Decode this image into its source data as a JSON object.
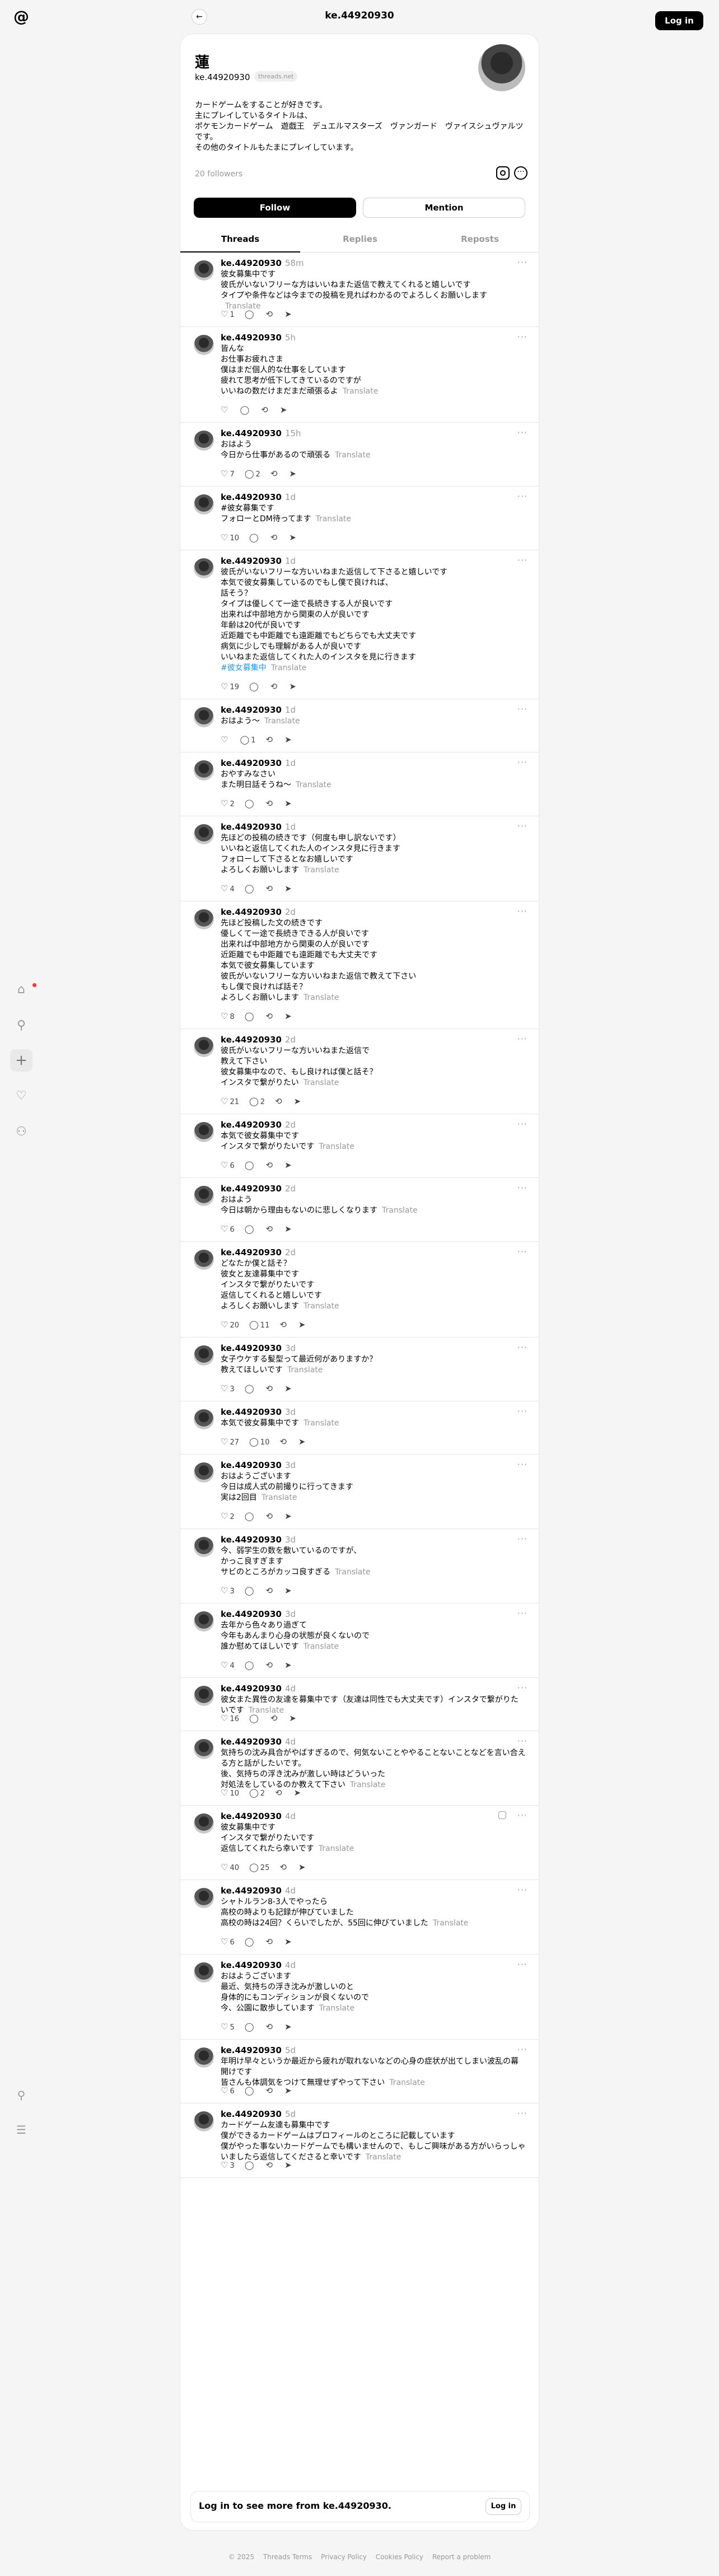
{
  "header": {
    "title": "ke.44920930",
    "login_label": "Log in",
    "back_icon": "arrow-left-icon"
  },
  "profile": {
    "name": "蓮",
    "handle": "ke.44920930",
    "chip": "threads.net",
    "bio": "カードゲームをすることが好きです。\n主にプレイしているタイトルは、\nポケモンカードゲーム　遊戯王　デュエルマスターズ　ヴァンガード　ヴァイスシュヴァルツです。\nその他のタイトルもたまにプレイしています。",
    "followers": "20 followers",
    "follow_label": "Follow",
    "mention_label": "Mention"
  },
  "tabs": [
    "Threads",
    "Replies",
    "Reposts"
  ],
  "translate_label": "Translate",
  "posts": [
    {
      "time": "58m",
      "lines": [
        "彼女募集中です",
        "彼氏がいないフリーな方はいいねまた返信で教えてくれると嬉しいです",
        "タイプや条件などは今までの投稿を見ればわかるのでよろしくお願いします"
      ],
      "likes": "1",
      "replies": "",
      "reposts": ""
    },
    {
      "time": "5h",
      "lines": [
        "皆んな",
        "お仕事お疲れさま",
        "僕はまだ個人的な仕事をしています",
        "疲れて思考が低下してきているのですが",
        "いいねの数だけまだまだ頑張るよ"
      ],
      "likes": "",
      "replies": "",
      "reposts": ""
    },
    {
      "time": "15h",
      "lines": [
        "おはよう",
        "今日から仕事があるので頑張る"
      ],
      "likes": "7",
      "replies": "2",
      "reposts": ""
    },
    {
      "time": "1d",
      "lines": [
        "#彼女募集です",
        "フォローとDM待ってます"
      ],
      "likes": "10",
      "replies": "",
      "reposts": ""
    },
    {
      "time": "1d",
      "lines": [
        "彼氏がいないフリーな方いいねまた返信して下さると嬉しいです",
        "本気で彼女募集しているのでもし僕で良ければ、",
        "話そう？",
        "タイプは優しくて一途で長続きする人が良いです",
        "出来れば中部地方から関東の人が良いです",
        "年齢は20代が良いです",
        "近距離でも中距離でも遠距離でもどちらでも大丈夫です",
        "病気に少しでも理解がある人が良いです",
        "いいねまた返信してくれた人のインスタを見に行きます",
        "#彼女募集中"
      ],
      "likes": "19",
      "replies": "",
      "reposts": ""
    },
    {
      "time": "1d",
      "lines": [
        "おはよう〜"
      ],
      "likes": "",
      "replies": "1",
      "reposts": ""
    },
    {
      "time": "1d",
      "lines": [
        "おやすみなさい",
        "また明日話そうね〜"
      ],
      "likes": "2",
      "replies": "",
      "reposts": ""
    },
    {
      "time": "1d",
      "lines": [
        "先ほどの投稿の続きです（何度も申し訳ないです）",
        "いいねと返信してくれた人のインスタ見に行きます",
        "フォローして下さるとなお嬉しいです",
        "よろしくお願いします"
      ],
      "likes": "4",
      "replies": "",
      "reposts": ""
    },
    {
      "time": "2d",
      "lines": [
        "先ほど投稿した文の続きです",
        "優しくて一途で長続きできる人が良いです",
        "出来れば中部地方から関東の人が良いです",
        "近距離でも中距離でも遠距離でも大丈夫です",
        "本気で彼女募集しています",
        "彼氏がいないフリーな方いいねまた返信で教えて下さい",
        "もし僕で良ければ話そ？",
        "よろしくお願いします"
      ],
      "likes": "8",
      "replies": "",
      "reposts": ""
    },
    {
      "time": "2d",
      "lines": [
        "彼氏がいないフリーな方いいねまた返信で",
        "教えて下さい",
        "彼女募集中なので、もし良ければ僕と話そ？",
        "インスタで繋がりたい"
      ],
      "likes": "21",
      "replies": "2",
      "reposts": ""
    },
    {
      "time": "2d",
      "lines": [
        "本気で彼女募集中です",
        "インスタで繋がりたいです"
      ],
      "likes": "6",
      "replies": "",
      "reposts": ""
    },
    {
      "time": "2d",
      "lines": [
        "おはよう",
        "今日は朝から理由もないのに悲しくなります"
      ],
      "likes": "6",
      "replies": "",
      "reposts": ""
    },
    {
      "time": "2d",
      "lines": [
        "どなたか僕と話そ？",
        "彼女と友達募集中です",
        "インスタで繋がりたいです",
        "返信してくれると嬉しいです",
        "よろしくお願いします"
      ],
      "likes": "20",
      "replies": "11",
      "reposts": ""
    },
    {
      "time": "3d",
      "lines": [
        "女子ウケする髪型って最近何がありますか？",
        "教えてほしいです"
      ],
      "likes": "3",
      "replies": "",
      "reposts": ""
    },
    {
      "time": "3d",
      "lines": [
        "本気で彼女募集中です"
      ],
      "likes": "27",
      "replies": "10",
      "reposts": ""
    },
    {
      "time": "3d",
      "lines": [
        "おはようございます",
        "今日は成人式の前撮りに行ってきます",
        "実は2回目"
      ],
      "likes": "2",
      "replies": "",
      "reposts": ""
    },
    {
      "time": "3d",
      "lines": [
        "今、弱学生の数を敷いているのですが、",
        "かっこ良すぎます",
        "サビのところがカッコ良すぎる"
      ],
      "likes": "3",
      "replies": "",
      "reposts": ""
    },
    {
      "time": "3d",
      "lines": [
        "去年から色々あり過ぎて",
        "今年もあんまり心身の状態が良くないので",
        "誰か慰めてほしいです"
      ],
      "likes": "4",
      "replies": "",
      "reposts": ""
    },
    {
      "time": "4d",
      "lines": [
        "彼女また異性の友達を募集中です（友達は同性でも大丈夫です）インスタで繋がりたいです"
      ],
      "likes": "16",
      "replies": "",
      "reposts": ""
    },
    {
      "time": "4d",
      "lines": [
        "気持ちの沈み具合がやばすぎるので、何気ないことややることないことなどを言い合える方と話がしたいです。",
        "後、気持ちの浮き沈みが激しい時はどういった",
        "対処法をしているのか教えて下さい"
      ],
      "likes": "10",
      "replies": "2",
      "reposts": ""
    },
    {
      "time": "4d",
      "lines": [
        "彼女募集中です",
        "インスタで繋がりたいです",
        "返信してくれたら幸いです"
      ],
      "likes": "40",
      "replies": "25",
      "reposts": ""
    },
    {
      "time": "4d",
      "lines": [
        "シャトルラン8-3人でやったら",
        "高校の時よりも記録が伸びていました",
        "高校の時は24回？くらいでしたが、55回に伸びていました"
      ],
      "likes": "6",
      "replies": "",
      "reposts": ""
    },
    {
      "time": "4d",
      "lines": [
        "おはようございます",
        "最近、気持ちの浮き沈みが激しいのと",
        "身体的にもコンディションが良くないので",
        "今、公園に散歩しています"
      ],
      "likes": "5",
      "replies": "",
      "reposts": ""
    },
    {
      "time": "5d",
      "lines": [
        "年明け早々というか最近から疲れが取れないなどの心身の症状が出てしまい波乱の幕開けです",
        "皆さんも体調気をつけて無理せずやって下さい"
      ],
      "likes": "6",
      "replies": "",
      "reposts": ""
    },
    {
      "time": "5d",
      "lines": [
        "カードゲーム友達も募集中です",
        "僕ができるカードゲームはプロフィールのところに記載しています",
        "僕がやった事ないカードゲームでも構いませんので、もしご興味がある方がいらっしゃいましたら返信してくださると幸いです"
      ],
      "likes": "3",
      "replies": "",
      "reposts": ""
    }
  ],
  "login_bar": {
    "text": "Log in to see more from ke.44920930.",
    "button": "Log in"
  },
  "footer": [
    "© 2025",
    "Threads Terms",
    "Privacy Policy",
    "Cookies Policy",
    "Report a problem"
  ]
}
